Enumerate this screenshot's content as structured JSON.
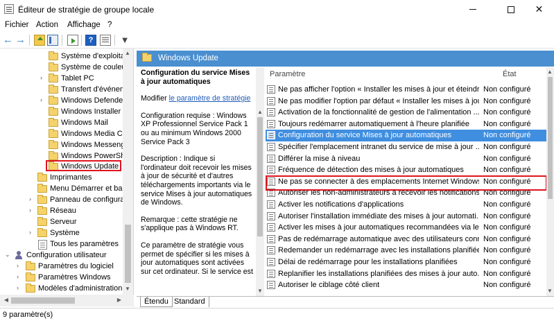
{
  "window": {
    "title": "Éditeur de stratégie de groupe locale",
    "minimize": "—",
    "maximize": "☐",
    "close": "✕"
  },
  "menu": {
    "items": [
      "Fichier",
      "Action",
      "Affichage",
      "?"
    ]
  },
  "toolbar": {
    "back": "←",
    "forward": "→",
    "filter": "▼"
  },
  "tree": {
    "items": [
      {
        "label": "Système d'exploitat",
        "expandable": false
      },
      {
        "label": "Système de couleur",
        "expandable": false
      },
      {
        "label": "Tablet PC",
        "expandable": true
      },
      {
        "label": "Transfert d'événem",
        "expandable": false
      },
      {
        "label": "Windows Defender",
        "expandable": true
      },
      {
        "label": "Windows Installer",
        "expandable": false
      },
      {
        "label": "Windows Mail",
        "expandable": false
      },
      {
        "label": "Windows Media Ce",
        "expandable": false
      },
      {
        "label": "Windows Messeng",
        "expandable": false
      },
      {
        "label": "Windows PowerShe",
        "expandable": false
      },
      {
        "label": "Windows Update",
        "expandable": false,
        "selected": true
      },
      {
        "label": "Imprimantes",
        "expandable": false
      },
      {
        "label": "Menu Démarrer et barr",
        "expandable": false
      },
      {
        "label": "Panneau de configurat",
        "expandable": true
      },
      {
        "label": "Réseau",
        "expandable": true
      },
      {
        "label": "Serveur",
        "expandable": false
      },
      {
        "label": "Système",
        "expandable": true
      },
      {
        "label": "Tous les paramètres",
        "expandable": false
      },
      {
        "label": "Configuration utilisateur",
        "expandable": true
      },
      {
        "label": "Paramètres du logiciel",
        "expandable": true
      },
      {
        "label": "Paramètres Windows",
        "expandable": true
      },
      {
        "label": "Modèles d'administration",
        "expandable": true
      }
    ]
  },
  "details": {
    "header": "Windows Update",
    "policy_title": "Configuration du service Mises à jour automatiques",
    "modify_prefix": "Modifier",
    "modify_link": "le paramètre de stratégie",
    "requirements": "Configuration requise : Windows XP Professionnel Service Pack 1 ou au minimum Windows 2000 Service Pack 3",
    "description": "Description : Indique si l'ordinateur doit recevoir les mises à jour de sécurité et d'autres téléchargements importants via le service Mises à jour automatiques de Windows.",
    "remark": "Remarque : cette stratégie ne s'applique pas à Windows RT.",
    "more": "Ce paramètre de stratégie vous permet de spécifier si les mises à jour automatiques sont activées sur cet ordinateur. Si le service est"
  },
  "list": {
    "col_param": "Paramètre",
    "col_state": "État",
    "rows": [
      {
        "name": "Ne pas afficher l'option « Installer les mises à jour et éteindr...",
        "state": "Non configuré"
      },
      {
        "name": "Ne pas modifier l'option par défaut « Installer les mises à jou...",
        "state": "Non configuré"
      },
      {
        "name": "Activation de la fonctionnalité de gestion de l'alimentation ...",
        "state": "Non configuré"
      },
      {
        "name": "Toujours redémarrer automatiquement à l'heure planifiée",
        "state": "Non configuré"
      },
      {
        "name": "Configuration du service Mises à jour automatiques",
        "state": "Non configuré",
        "selected": true
      },
      {
        "name": "Spécifier l'emplacement intranet du service de mise à jour ...",
        "state": "Non configuré"
      },
      {
        "name": "Différer la mise à niveau",
        "state": "Non configuré"
      },
      {
        "name": "Fréquence de détection des mises à jour automatiques",
        "state": "Non configuré"
      },
      {
        "name": "Ne pas se connecter à des emplacements Internet Windows ...",
        "state": "Non configuré"
      },
      {
        "name": "Autoriser les non-administrateurs à recevoir les notifications...",
        "state": "Non configuré"
      },
      {
        "name": "Activer les notifications d'applications",
        "state": "Non configuré"
      },
      {
        "name": "Autoriser l'installation immédiate des mises à jour automati...",
        "state": "Non configuré"
      },
      {
        "name": "Activer les mises à jour automatiques recommandées via le ...",
        "state": "Non configuré"
      },
      {
        "name": "Pas de redémarrage automatique avec des utilisateurs conn...",
        "state": "Non configuré"
      },
      {
        "name": "Redemander un redémarrage avec les installations planifiées",
        "state": "Non configuré"
      },
      {
        "name": "Délai de redémarrage pour les installations planifiées",
        "state": "Non configuré"
      },
      {
        "name": "Replanifier les installations planifiées des mises à jour auto...",
        "state": "Non configuré"
      },
      {
        "name": "Autoriser le ciblage côté client",
        "state": "Non configuré"
      }
    ]
  },
  "tabs": [
    "Étendu",
    "Standard"
  ],
  "status": "9 paramètre(s)",
  "colors": {
    "selection": "#3f8ee0",
    "header_band": "#4a8fcf",
    "highlight_box": "#e0141e"
  }
}
